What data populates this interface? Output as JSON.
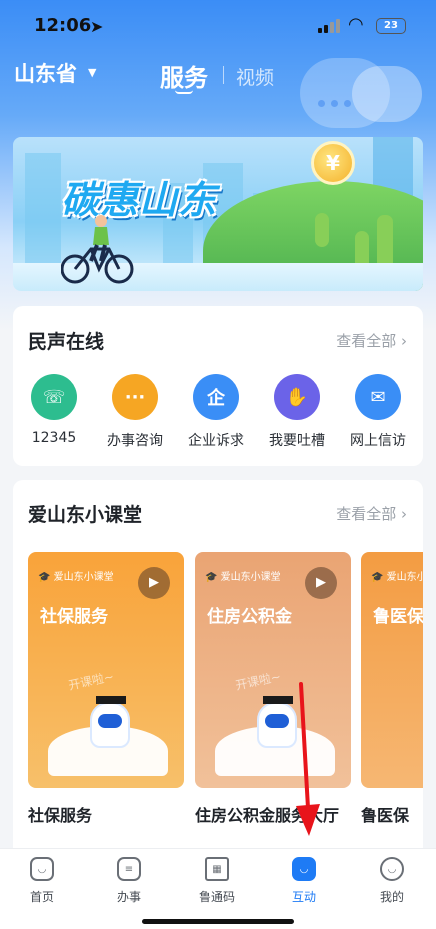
{
  "status_bar": {
    "time": "12:06",
    "battery": "23"
  },
  "header": {
    "province": "山东省",
    "tabs": [
      "服务",
      "视频"
    ]
  },
  "banner": {
    "title": "碳惠山东",
    "coin_symbol": "¥"
  },
  "voice_section": {
    "title": "民声在线",
    "see_all": "查看全部 ›",
    "items": [
      {
        "label": "12345",
        "icon": "hotline-12345-icon",
        "color": "#2dbd8f",
        "glyph": "☏"
      },
      {
        "label": "办事咨询",
        "icon": "chat-bubble-icon",
        "color": "#f6a623",
        "glyph": "···"
      },
      {
        "label": "企业诉求",
        "icon": "enterprise-icon",
        "color": "#3a8ef6",
        "glyph": "企"
      },
      {
        "label": "我要吐槽",
        "icon": "thumbs-down-icon",
        "color": "#6b63e8",
        "glyph": "👎"
      },
      {
        "label": "网上信访",
        "icon": "mailbox-icon",
        "color": "#3a8ef6",
        "glyph": "✉"
      }
    ]
  },
  "classroom_section": {
    "title": "爱山东小课堂",
    "see_all": "查看全部 ›",
    "badge": "爱山东小课堂",
    "watermark": "开课啦~",
    "courses": [
      {
        "card_title": "社保服务",
        "caption": "社保服务",
        "bg": "#f7a03b"
      },
      {
        "card_title": "住房公积金",
        "caption": "住房公积金服务大厅",
        "bg": "#eba77a"
      },
      {
        "card_title": "鲁医保",
        "caption": "鲁医保",
        "bg": "#f29c42"
      }
    ]
  },
  "tabbar": [
    {
      "label": "首页",
      "icon": "home-icon",
      "active": false
    },
    {
      "label": "办事",
      "icon": "tasks-icon",
      "active": false
    },
    {
      "label": "鲁通码",
      "icon": "qr-code-icon",
      "active": false
    },
    {
      "label": "互动",
      "icon": "interact-icon",
      "active": true
    },
    {
      "label": "我的",
      "icon": "profile-icon",
      "active": false
    }
  ],
  "annotation": {
    "arrow_color": "#e8141b"
  }
}
